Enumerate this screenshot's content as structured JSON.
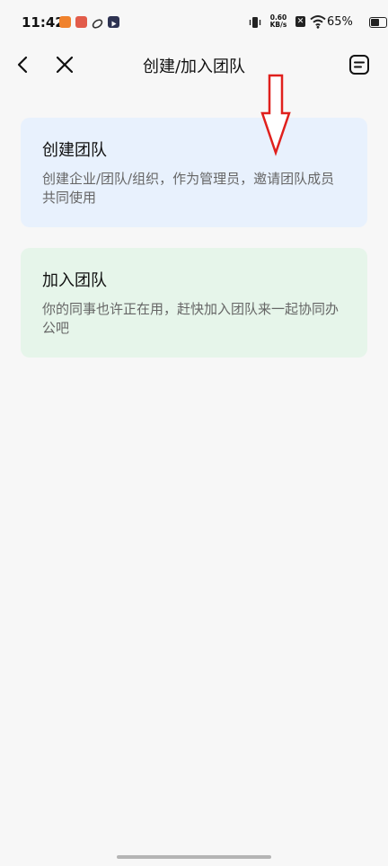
{
  "status_bar": {
    "time": "11:42",
    "net_speed_value": "0.60",
    "net_speed_unit": "KB/s",
    "battery_percent": "65%",
    "battery_level": 0.65
  },
  "header": {
    "title": "创建/加入团队"
  },
  "cards": {
    "create": {
      "title": "创建团队",
      "description": "创建企业/团队/组织，作为管理员，邀请团队成员共同使用"
    },
    "join": {
      "title": "加入团队",
      "description": "你的同事也许正在用，赶快加入团队来一起协同办公吧"
    }
  },
  "icons": {
    "back": "back-arrow-icon",
    "close": "close-icon",
    "menu": "menu-icon"
  },
  "colors": {
    "create_card_bg": "#e8f1fd",
    "join_card_bg": "#e6f5ea",
    "annotation_arrow": "#e0201d"
  }
}
